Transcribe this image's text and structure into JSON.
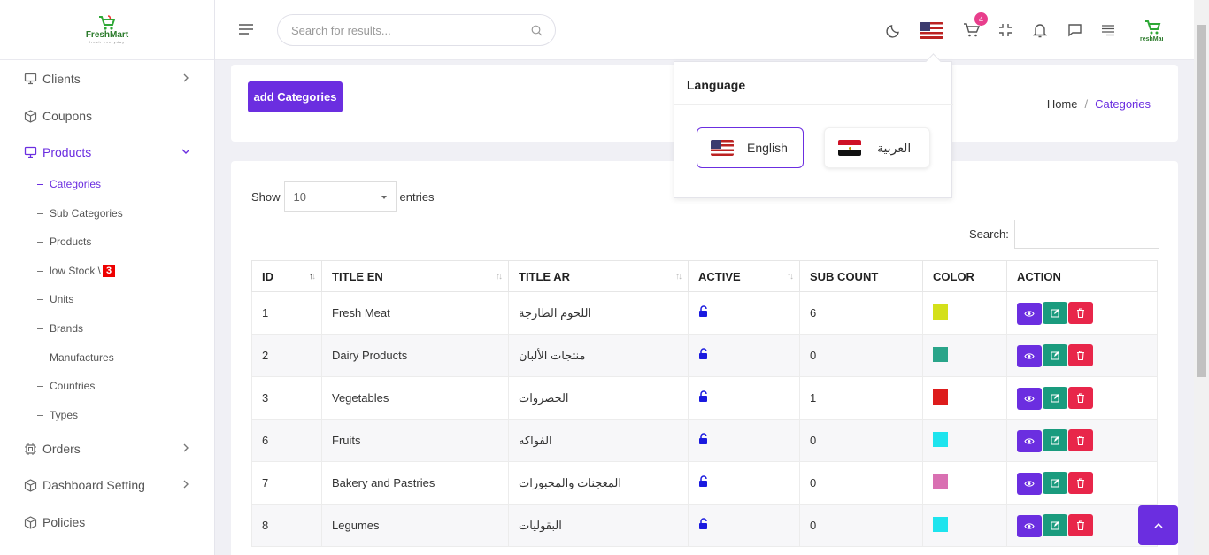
{
  "brand": {
    "name": "FreshMart",
    "tagline": "fresh everyday"
  },
  "sidebar": {
    "items": [
      {
        "label": "Clients",
        "icon": "monitor-icon"
      },
      {
        "label": "Coupons",
        "icon": "box-icon"
      },
      {
        "label": "Products",
        "icon": "monitor-icon"
      },
      {
        "label": "Orders",
        "icon": "chip-icon"
      },
      {
        "label": "Dashboard Setting",
        "icon": "box-icon"
      },
      {
        "label": "Policies",
        "icon": "box-icon"
      }
    ],
    "subitems": [
      "Categories",
      "Sub Categories",
      "Products",
      "low Stock \\",
      "Units",
      "Brands",
      "Manufactures",
      "Countries",
      "Types"
    ],
    "low_stock_count": "3"
  },
  "topbar": {
    "search_placeholder": "Search for results...",
    "cart_count": "4"
  },
  "page": {
    "add_button": "add Categories",
    "breadcrumb": {
      "home": "Home",
      "sep": "/",
      "current": "Categories"
    }
  },
  "table_controls": {
    "show": "Show",
    "page_size": "10",
    "entries": "entries",
    "search_label": "Search:"
  },
  "table": {
    "headers": [
      "ID",
      "TITLE EN",
      "TITLE AR",
      "ACTIVE",
      "SUB COUNT",
      "COLOR",
      "ACTION"
    ],
    "rows": [
      {
        "id": "1",
        "title_en": "Fresh Meat",
        "title_ar": "اللحوم الطازجة",
        "sub_count": "6",
        "color": "#d4e01a"
      },
      {
        "id": "2",
        "title_en": "Dairy Products",
        "title_ar": "منتجات الألبان",
        "sub_count": "0",
        "color": "#2aa58a"
      },
      {
        "id": "3",
        "title_en": "Vegetables",
        "title_ar": "الخضروات",
        "sub_count": "1",
        "color": "#dd1c1c"
      },
      {
        "id": "6",
        "title_en": "Fruits",
        "title_ar": "الفواكه",
        "sub_count": "0",
        "color": "#1ee4ee"
      },
      {
        "id": "7",
        "title_en": "Bakery and Pastries",
        "title_ar": "المعجنات والمخبوزات",
        "sub_count": "0",
        "color": "#d970b2"
      },
      {
        "id": "8",
        "title_en": "Legumes",
        "title_ar": "البقوليات",
        "sub_count": "0",
        "color": "#1ee4ee"
      }
    ]
  },
  "language_dropdown": {
    "title": "Language",
    "options": [
      {
        "label": "English",
        "flag": "us-flag-icon"
      },
      {
        "label": "العربية",
        "flag": "egypt-flag-icon"
      }
    ]
  },
  "colors": {
    "accent": "#6b2ee0",
    "edit": "#1a9b7e",
    "delete": "#e8264a"
  }
}
